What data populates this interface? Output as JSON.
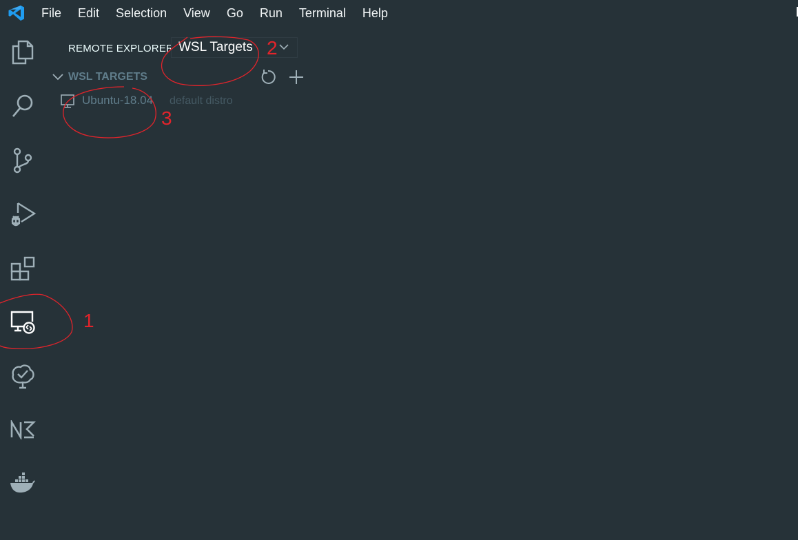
{
  "menubar": {
    "items": [
      "File",
      "Edit",
      "Selection",
      "View",
      "Go",
      "Run",
      "Terminal",
      "Help"
    ]
  },
  "activitybar": {
    "items": [
      {
        "icon": "files-icon",
        "name": "explorer"
      },
      {
        "icon": "search-icon",
        "name": "search"
      },
      {
        "icon": "source-control-icon",
        "name": "source-control"
      },
      {
        "icon": "run-debug-icon",
        "name": "run-debug"
      },
      {
        "icon": "extensions-icon",
        "name": "extensions"
      },
      {
        "icon": "remote-explorer-icon",
        "name": "remote-explorer",
        "active": true
      },
      {
        "icon": "tree-check-icon",
        "name": "tree-extension"
      },
      {
        "icon": "n2-icon",
        "name": "n2-extension"
      },
      {
        "icon": "docker-icon",
        "name": "docker"
      }
    ]
  },
  "sidebar": {
    "title": "REMOTE EXPLORER",
    "target_select": {
      "value": "WSL Targets"
    },
    "section": {
      "title": "WSL TARGETS",
      "actions": [
        {
          "icon": "refresh-icon",
          "name": "refresh"
        },
        {
          "icon": "add-icon",
          "name": "add"
        }
      ]
    },
    "targets": [
      {
        "label": "Ubuntu-18.04",
        "description": "default distro",
        "icon": "monitor-icon"
      }
    ]
  },
  "annotations": {
    "labels": [
      "1",
      "2",
      "3"
    ],
    "color": "#e3242b"
  },
  "colors": {
    "background": "#263238",
    "muted_text": "#607d8b",
    "dim_text": "#455a64",
    "icon": "#9fb0b8",
    "accent": "#e3242b"
  }
}
